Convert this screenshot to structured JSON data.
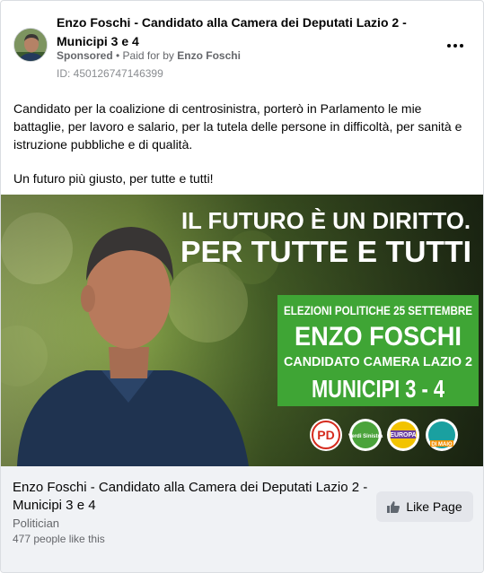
{
  "post": {
    "page_name": "Enzo Foschi - Candidato alla Camera dei Deputati Lazio 2 - Municipi 3 e 4",
    "sponsored": "Sponsored",
    "separator": " • ",
    "paid_for_prefix": "Paid for by ",
    "payer": "Enzo Foschi",
    "ad_id": "ID: 450126747146399",
    "body_paragraphs": [
      "Candidato per la coalizione di centrosinistra, porterò in Parlamento le mie battaglie, per lavoro e salario, per la tutela delle persone in difficoltà, per sanità e istruzione pubbliche e di qualità.",
      "Un futuro più giusto, per tutte e tutti!"
    ]
  },
  "creative": {
    "headline_1": "IL FUTURO È UN DIRITTO.",
    "headline_2": "PER TUTTE E TUTTI",
    "box_line_1": "ELEZIONI POLITICHE 25 SETTEMBRE",
    "box_line_2": "ENZO FOSCHI",
    "box_line_3": "CANDIDATO CAMERA LAZIO 2",
    "box_line_4": "MUNICIPI 3 - 4",
    "logos": [
      {
        "name": "pd",
        "text": "PD"
      },
      {
        "name": "verdi-sinistra",
        "text": "Verdi Sinistra"
      },
      {
        "name": "europa",
        "text": "EUROPA"
      },
      {
        "name": "impegno-civico",
        "text": "DI MAIO"
      }
    ],
    "colors": {
      "box_green": "#3fa535",
      "headline_white": "#ffffff",
      "shirt_navy": "#1f3350"
    }
  },
  "footer": {
    "title": "Enzo Foschi - Candidato alla Camera dei Deputati Lazio 2 - Municipi 3 e 4",
    "category": "Politician",
    "likes": "477 people like this",
    "like_button": "Like Page"
  },
  "colors": {
    "text_primary": "#050505",
    "text_secondary": "#65676b",
    "footer_bg": "#f0f2f5",
    "button_bg": "#e4e6eb"
  }
}
